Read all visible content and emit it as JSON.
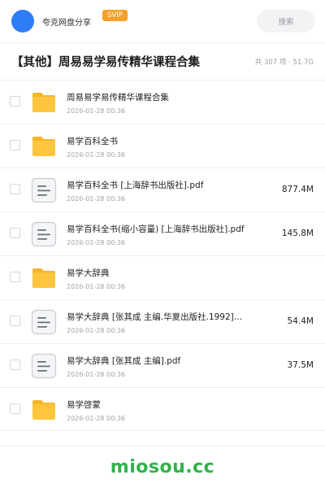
{
  "header": {
    "user_name": "夸克网盘分享",
    "badge": "SVIP",
    "search_placeholder": "搜索"
  },
  "folder": {
    "title": "【其他】周易易学易传精华课程合集",
    "summary": "共 307 项 · 51.7G"
  },
  "files": [
    {
      "name": "周易易学易传精华课程合集",
      "date": "2026-01-28 00:36",
      "size": "",
      "type": "folder-icon"
    },
    {
      "name": "易学百科全书",
      "date": "2026-01-28 00:36",
      "size": "",
      "type": "folder-icon"
    },
    {
      "name": "易学百科全书 [上海辞书出版社].pdf",
      "date": "2026-01-28 00:36",
      "size": "877.4M",
      "type": "document-icon"
    },
    {
      "name": "易学百科全书(缩小容量) [上海辞书出版社].pdf",
      "date": "2026-01-28 00:36",
      "size": "145.8M",
      "type": "document-icon"
    },
    {
      "name": "易学大辞典",
      "date": "2026-01-28 00:36",
      "size": "",
      "type": "folder-icon"
    },
    {
      "name": "易学大辞典 [张其成 主编.华夏出版社.1992]…",
      "date": "2026-01-28 00:36",
      "size": "54.4M",
      "type": "document-icon"
    },
    {
      "name": "易学大辞典 [张其成 主编].pdf",
      "date": "2026-01-28 00:36",
      "size": "37.5M",
      "type": "document-icon"
    },
    {
      "name": "易学啓蒙",
      "date": "2026-01-28 00:36",
      "size": "",
      "type": "folder-icon"
    }
  ],
  "watermark": "miosou.cc",
  "colors": {
    "accent": "#2f7df6",
    "badge": "#f7a02a",
    "folder": "#ffc53d",
    "watermark": "#2fb24a"
  }
}
